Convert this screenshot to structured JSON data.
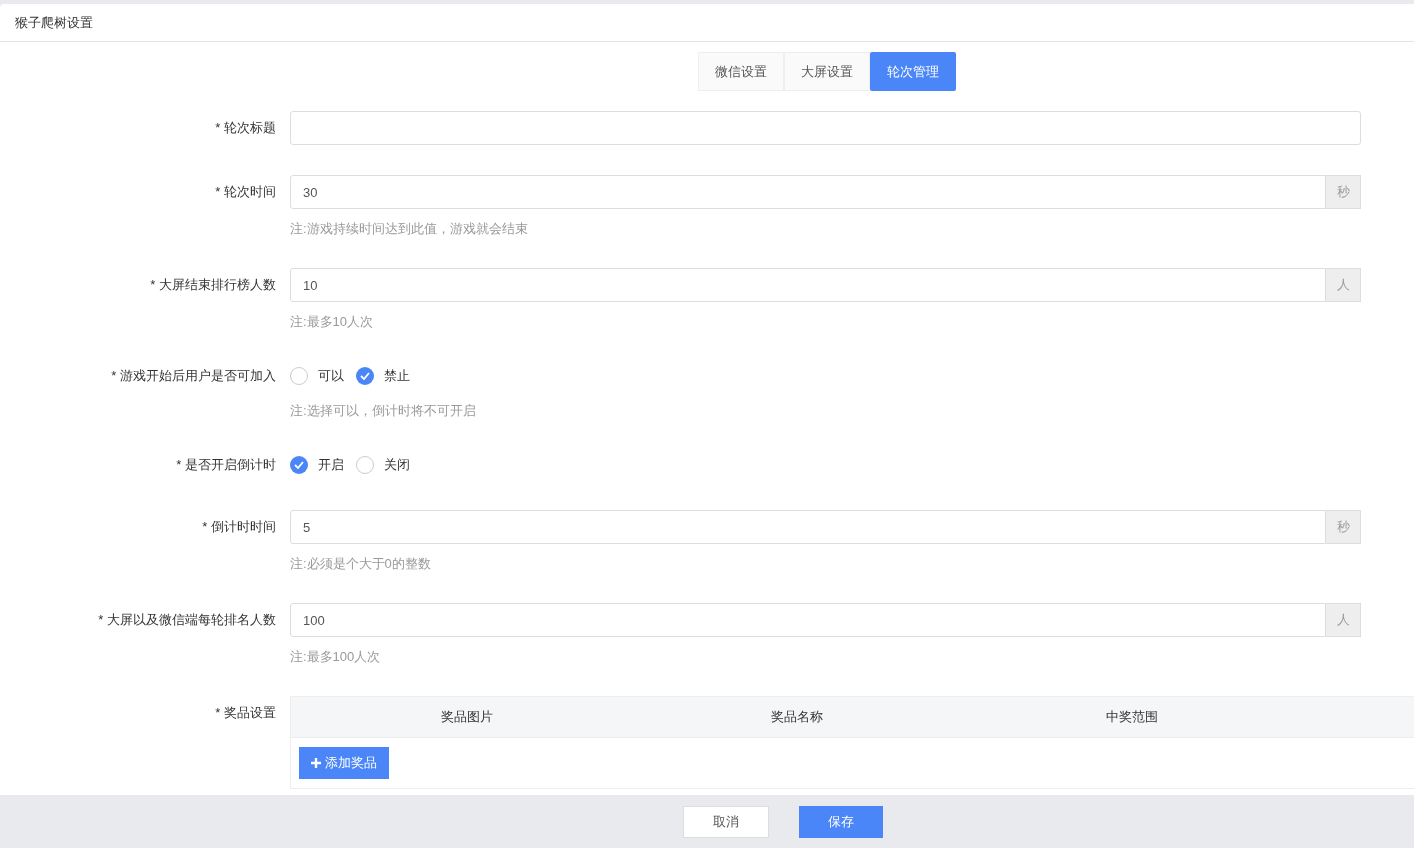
{
  "page_title": "猴子爬树设置",
  "tabs": [
    {
      "label": "微信设置",
      "selected": false
    },
    {
      "label": "大屏设置",
      "selected": false
    },
    {
      "label": "轮次管理",
      "selected": true
    }
  ],
  "fields": [
    {
      "kind": "text",
      "label": "* 轮次标题"
    },
    {
      "kind": "addon",
      "label": "* 轮次时间",
      "value": "30",
      "addon": "秒",
      "note": "注:游戏持续时间达到此值，游戏就会结束"
    },
    {
      "kind": "addon",
      "label": "* 大屏结束排行榜人数",
      "value": "10",
      "addon": "人",
      "note": "注:最多10人次"
    },
    {
      "kind": "radio",
      "label": "* 游戏开始后用户是否可加入",
      "options": [
        {
          "label": "可以",
          "selected": false
        },
        {
          "label": "禁止",
          "selected": true
        }
      ],
      "note": "注:选择可以，倒计时将不可开启"
    },
    {
      "kind": "radio",
      "label": "* 是否开启倒计时",
      "options": [
        {
          "label": "开启",
          "selected": true
        },
        {
          "label": "关闭",
          "selected": false
        }
      ]
    },
    {
      "kind": "addon",
      "label": "* 倒计时时间",
      "value": "5",
      "addon": "秒",
      "note": "注:必须是个大于0的整数"
    },
    {
      "kind": "addon",
      "label": "* 大屏以及微信端每轮排名人数",
      "value": "100",
      "addon": "人",
      "note": "注:最多100人次"
    },
    {
      "kind": "table",
      "label": "* 奖品设置",
      "columns": [
        "奖品图片",
        "奖品名称",
        "中奖范围"
      ],
      "add_button": "添加奖品"
    }
  ],
  "footer_buttons": [
    {
      "label": "取消",
      "kind": "secondary"
    },
    {
      "label": "保存",
      "kind": "primary"
    }
  ]
}
